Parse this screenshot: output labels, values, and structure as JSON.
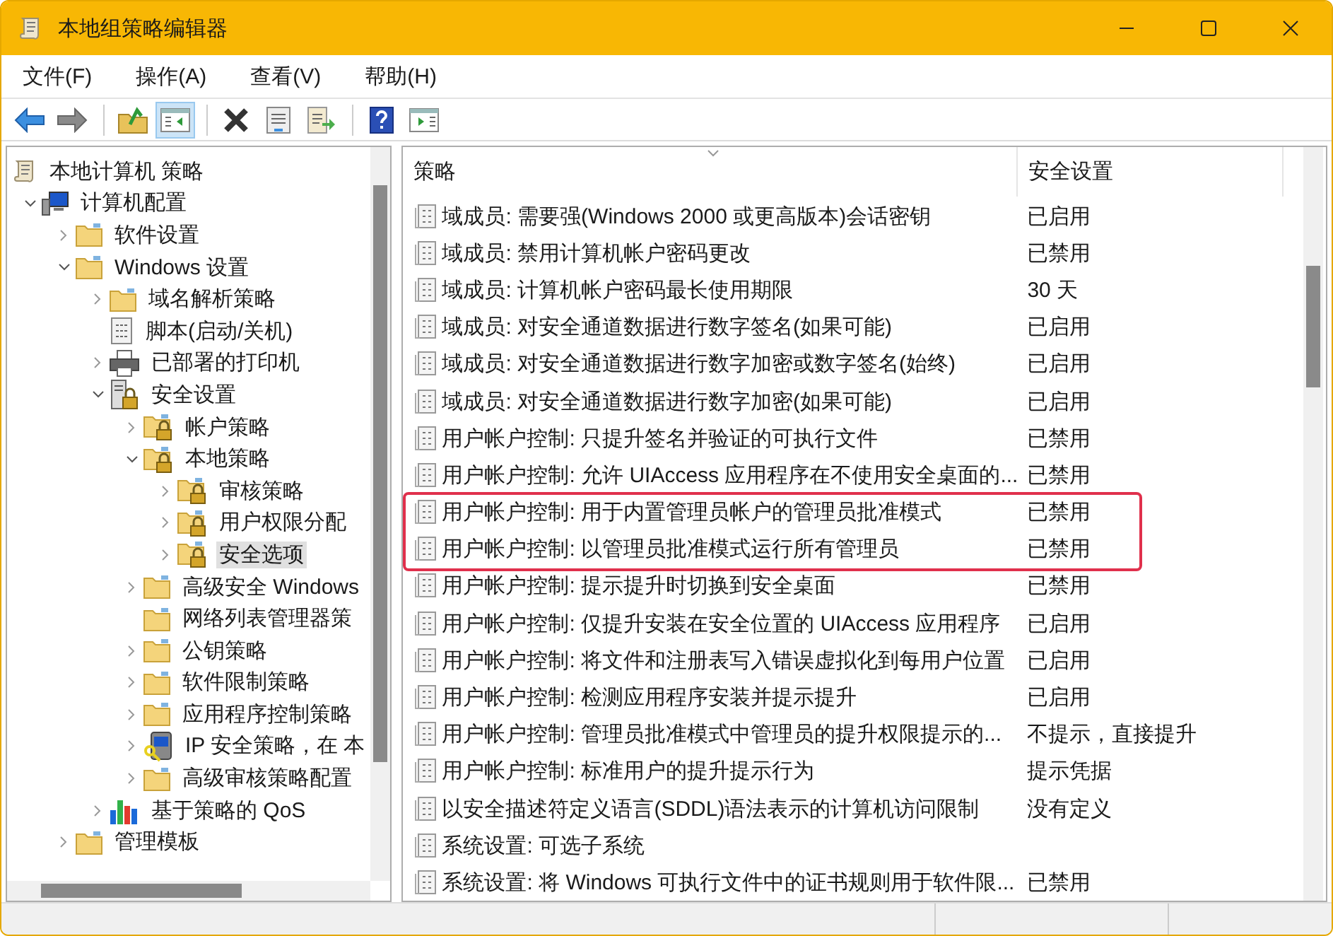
{
  "window": {
    "title": "本地组策略编辑器"
  },
  "menu": [
    "文件(F)",
    "操作(A)",
    "查看(V)",
    "帮助(H)"
  ],
  "toolbar": [
    {
      "kind": "back",
      "pressed": false
    },
    {
      "kind": "forward",
      "pressed": false
    },
    {
      "kind": "sep"
    },
    {
      "kind": "up",
      "pressed": false
    },
    {
      "kind": "tree",
      "pressed": true
    },
    {
      "kind": "sep"
    },
    {
      "kind": "delete",
      "pressed": false
    },
    {
      "kind": "properties",
      "pressed": false
    },
    {
      "kind": "export",
      "pressed": false
    },
    {
      "kind": "sep"
    },
    {
      "kind": "help",
      "pressed": false
    },
    {
      "kind": "pane",
      "pressed": false
    }
  ],
  "tree": [
    {
      "label": "本地计算机 策略",
      "kind": "scroll",
      "selected": false,
      "children": [
        {
          "label": "计算机配置",
          "kind": "computer",
          "expanded": true,
          "selected": false,
          "children": [
            {
              "label": "软件设置",
              "kind": "folder",
              "expanded": false,
              "selected": false
            },
            {
              "label": "Windows 设置",
              "kind": "folder",
              "expanded": true,
              "selected": false,
              "children": [
                {
                  "label": "域名解析策略",
                  "kind": "folder",
                  "expanded": false,
                  "selected": false
                },
                {
                  "label": "脚本(启动/关机)",
                  "kind": "script",
                  "selected": false
                },
                {
                  "label": "已部署的打印机",
                  "kind": "printer",
                  "expanded": false,
                  "selected": false
                },
                {
                  "label": "安全设置",
                  "kind": "secure",
                  "expanded": true,
                  "selected": false,
                  "children": [
                    {
                      "label": "帐户策略",
                      "kind": "lockfolder",
                      "expanded": false,
                      "selected": false
                    },
                    {
                      "label": "本地策略",
                      "kind": "lockfolder",
                      "expanded": true,
                      "selected": false,
                      "children": [
                        {
                          "label": "审核策略",
                          "kind": "lockfolder",
                          "expanded": false,
                          "selected": false
                        },
                        {
                          "label": "用户权限分配",
                          "kind": "lockfolder",
                          "expanded": false,
                          "selected": false
                        },
                        {
                          "label": "安全选项",
                          "kind": "lockfolder",
                          "expanded": false,
                          "selected": true
                        }
                      ]
                    },
                    {
                      "label": "高级安全 Windows",
                      "kind": "folder",
                      "expanded": false,
                      "selected": false
                    },
                    {
                      "label": "网络列表管理器策",
                      "kind": "folder",
                      "selected": false
                    },
                    {
                      "label": "公钥策略",
                      "kind": "folder",
                      "expanded": false,
                      "selected": false
                    },
                    {
                      "label": "软件限制策略",
                      "kind": "folder",
                      "expanded": false,
                      "selected": false
                    },
                    {
                      "label": "应用程序控制策略",
                      "kind": "folder",
                      "expanded": false,
                      "selected": false
                    },
                    {
                      "label": "IP 安全策略，在 本",
                      "kind": "ipsec",
                      "expanded": false,
                      "selected": false
                    },
                    {
                      "label": "高级审核策略配置",
                      "kind": "folder",
                      "expanded": false,
                      "selected": false
                    }
                  ]
                },
                {
                  "label": "基于策略的 QoS",
                  "kind": "chart",
                  "expanded": false,
                  "selected": false
                }
              ]
            },
            {
              "label": "管理模板",
              "kind": "folder",
              "expanded": false,
              "selected": false
            }
          ]
        }
      ]
    }
  ],
  "table": {
    "columns": [
      "策略",
      "安全设置"
    ],
    "rows": [
      {
        "policy": "域成员: 需要强(Windows 2000 或更高版本)会话密钥",
        "setting": "已启用",
        "highlighted": false
      },
      {
        "policy": "域成员: 禁用计算机帐户密码更改",
        "setting": "已禁用",
        "highlighted": false
      },
      {
        "policy": "域成员: 计算机帐户密码最长使用期限",
        "setting": "30 天",
        "highlighted": false
      },
      {
        "policy": "域成员: 对安全通道数据进行数字签名(如果可能)",
        "setting": "已启用",
        "highlighted": false
      },
      {
        "policy": "域成员: 对安全通道数据进行数字加密或数字签名(始终)",
        "setting": "已启用",
        "highlighted": false
      },
      {
        "policy": "域成员: 对安全通道数据进行数字加密(如果可能)",
        "setting": "已启用",
        "highlighted": false
      },
      {
        "policy": "用户帐户控制: 只提升签名并验证的可执行文件",
        "setting": "已禁用",
        "highlighted": false
      },
      {
        "policy": "用户帐户控制: 允许 UIAccess 应用程序在不使用安全桌面的...",
        "setting": "已禁用",
        "highlighted": false
      },
      {
        "policy": "用户帐户控制: 用于内置管理员帐户的管理员批准模式",
        "setting": "已禁用",
        "highlighted": true
      },
      {
        "policy": "用户帐户控制: 以管理员批准模式运行所有管理员",
        "setting": "已禁用",
        "highlighted": true
      },
      {
        "policy": "用户帐户控制: 提示提升时切换到安全桌面",
        "setting": "已禁用",
        "highlighted": false
      },
      {
        "policy": "用户帐户控制: 仅提升安装在安全位置的 UIAccess 应用程序",
        "setting": "已启用",
        "highlighted": false
      },
      {
        "policy": "用户帐户控制: 将文件和注册表写入错误虚拟化到每用户位置",
        "setting": "已启用",
        "highlighted": false
      },
      {
        "policy": "用户帐户控制: 检测应用程序安装并提示提升",
        "setting": "已启用",
        "highlighted": false
      },
      {
        "policy": "用户帐户控制: 管理员批准模式中管理员的提升权限提示的...",
        "setting": "不提示，直接提升",
        "highlighted": false
      },
      {
        "policy": "用户帐户控制: 标准用户的提升提示行为",
        "setting": "提示凭据",
        "highlighted": false
      },
      {
        "policy": "以安全描述符定义语言(SDDL)语法表示的计算机访问限制",
        "setting": "没有定义",
        "highlighted": false
      },
      {
        "policy": "系统设置: 可选子系统",
        "highlighted": false
      },
      {
        "policy": "系统设置: 将 Windows 可执行文件中的证书规则用于软件限...",
        "setting": "已禁用",
        "highlighted": false
      }
    ]
  }
}
